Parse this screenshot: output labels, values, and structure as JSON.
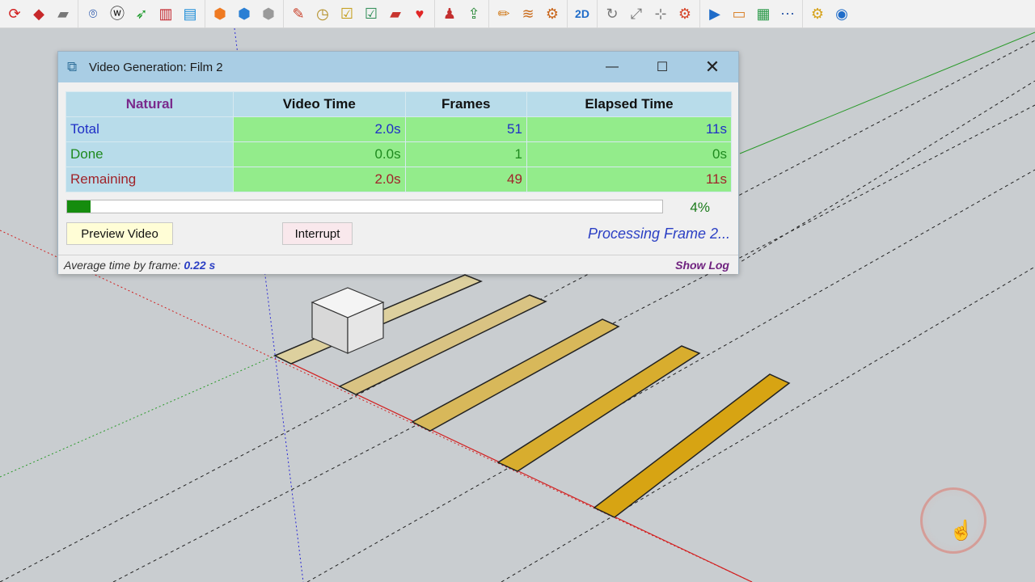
{
  "toolbar": {
    "icons": [
      "refresh-icon",
      "ruby-icon",
      "warehouse-icon",
      "location-pin-icon",
      "extension-warehouse-icon",
      "rocket-icon",
      "bar-chart-icon",
      "comment-icon",
      "orange-box-icon",
      "blue-box-icon",
      "gray-box-icon",
      "paint-icon",
      "clock-icon",
      "checklist-icon",
      "checklist-2-icon",
      "folder-red-icon",
      "heart-icon",
      "person-icon",
      "export-icon",
      "pencil-icon",
      "layers-icon",
      "settings-tool-icon",
      "glasses-2d-icon",
      "rotate-icon",
      "move-icon",
      "dimension-icon",
      "gear-multi-icon",
      "play-video-icon",
      "folder-open-icon",
      "clipboard-icon",
      "more-icon",
      "settings-icon",
      "eye-icon"
    ],
    "label_2d": "2D"
  },
  "dialog": {
    "title": "Video Generation: Film 2",
    "icon": "sketchup-icon",
    "window_buttons": {
      "minimize": "—",
      "maximize": "☐",
      "close": "✕"
    },
    "table": {
      "headers": [
        "Natural",
        "Video Time",
        "Frames",
        "Elapsed Time"
      ],
      "rows": [
        {
          "label": "Total",
          "video_time": "2.0s",
          "frames": "51",
          "elapsed": "11s"
        },
        {
          "label": "Done",
          "video_time": "0.0s",
          "frames": "1",
          "elapsed": "0s"
        },
        {
          "label": "Remaining",
          "video_time": "2.0s",
          "frames": "49",
          "elapsed": "11s"
        }
      ]
    },
    "progress": {
      "fraction": 0.04,
      "label": "4%"
    },
    "buttons": {
      "preview": "Preview Video",
      "interrupt": "Interrupt"
    },
    "processing_text": "Processing Frame 2...",
    "status": {
      "avg_label": "Average time by frame:",
      "avg_value": "0.22 s",
      "show_log": "Show Log"
    }
  },
  "colors": {
    "table_header_bg": "#b8dcea",
    "value_cell_bg": "#93ec8b",
    "total_text": "#1f2fc6",
    "done_text": "#1f8a1f",
    "remaining_text": "#a0242a",
    "progress_fill": "#158c0e",
    "plank_fill": "#d7a413"
  }
}
